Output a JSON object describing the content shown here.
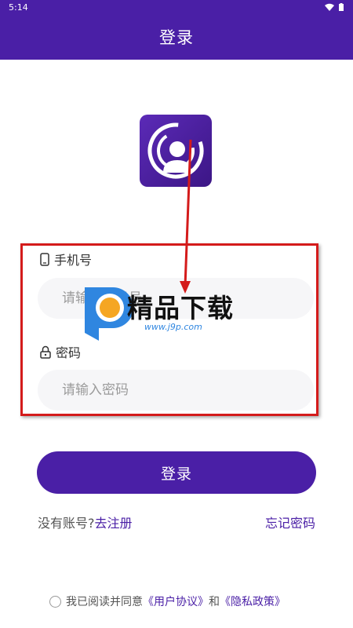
{
  "status": {
    "time": "5:14"
  },
  "header": {
    "title": "登录"
  },
  "form": {
    "phone_label": "手机号",
    "phone_placeholder": "请输入手机号",
    "password_label": "密码",
    "password_placeholder": "请输入密码"
  },
  "actions": {
    "login_label": "登录",
    "no_account": "没有账号?",
    "register_link": "去注册",
    "forgot_link": "忘记密码"
  },
  "agreement": {
    "prefix": "我已阅读并同意",
    "user_agreement": "《用户协议》",
    "and": "和",
    "privacy_policy": "《隐私政策》"
  },
  "watermark": {
    "text": "精品下载",
    "url": "www.j9p.com"
  },
  "colors": {
    "primary": "#4a1fa6",
    "annotation": "#d41b1b"
  }
}
